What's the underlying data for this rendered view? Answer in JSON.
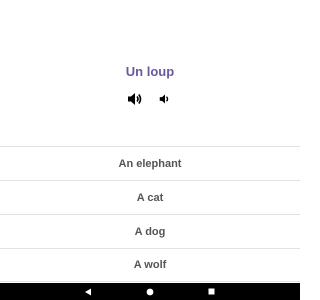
{
  "question": {
    "prompt": "Un loup"
  },
  "audio": {
    "normal_icon": "speaker-icon",
    "slow_icon": "speaker-slow-icon"
  },
  "answers": [
    {
      "label": "An elephant"
    },
    {
      "label": "A cat"
    },
    {
      "label": "A dog"
    },
    {
      "label": "A wolf"
    }
  ],
  "navbar": {
    "back_icon": "back-triangle-icon",
    "home_icon": "home-circle-icon",
    "recents_icon": "recents-square-icon"
  },
  "colors": {
    "prompt": "#6a5a9c",
    "answer_text": "#555555",
    "divider": "#e2e2e2",
    "navbar": "#000000"
  }
}
